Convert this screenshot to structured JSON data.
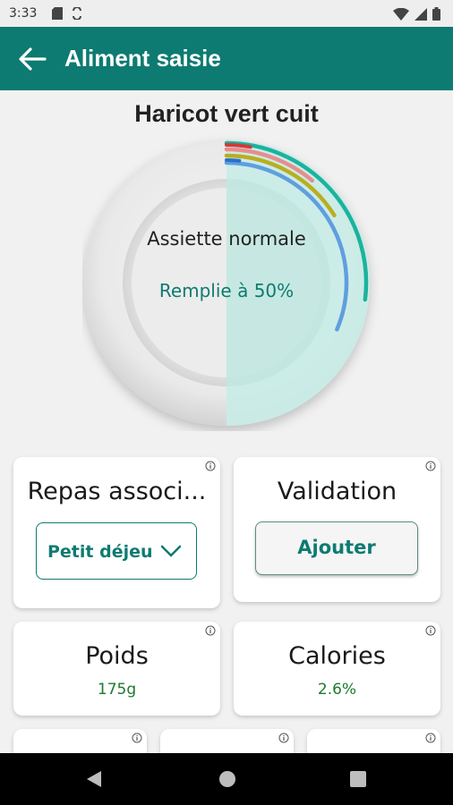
{
  "status_bar": {
    "time": "3:33"
  },
  "app_bar": {
    "title": "Aliment saisie",
    "back_icon": "arrow-left-icon"
  },
  "food": {
    "name": "Haricot vert cuit"
  },
  "plate": {
    "label": "Assiette normale",
    "fill_text": "Remplie à 50%",
    "fill_fraction": 0.5,
    "fill_color": "#c9ebe6",
    "arc_colors": [
      "#1bb39e",
      "#e88d8d",
      "#b9ae22",
      "#5f9ee0",
      "#d23a3a",
      "#2b70c9"
    ]
  },
  "cards": {
    "repas": {
      "title": "Repas associ...",
      "selected": "Petit déjeu"
    },
    "validation": {
      "title": "Validation",
      "button": "Ajouter"
    },
    "poids": {
      "title": "Poids",
      "value": "175g"
    },
    "calories": {
      "title": "Calories",
      "value": "2.6%"
    }
  },
  "colors": {
    "primary": "#0d7b71",
    "value_green": "#1d7a2e"
  }
}
